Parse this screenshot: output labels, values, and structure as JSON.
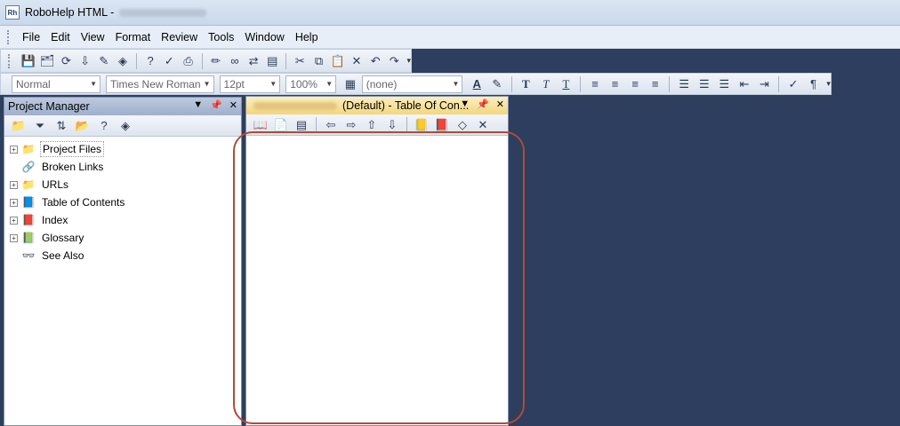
{
  "window": {
    "title": "RoboHelp HTML -",
    "icon_text": "Rh"
  },
  "menu": [
    "File",
    "Edit",
    "View",
    "Format",
    "Review",
    "Tools",
    "Window",
    "Help"
  ],
  "toolbar2": {
    "style": "Normal",
    "font": "Times New Roman",
    "size": "12pt",
    "zoom": "100%",
    "dropdown_value": "(none)"
  },
  "project_manager": {
    "title": "Project Manager",
    "tree": [
      {
        "label": "Project Files",
        "expandable": true,
        "icon": "folder-question-icon"
      },
      {
        "label": "Broken Links",
        "expandable": false,
        "icon": "broken-link-icon"
      },
      {
        "label": "URLs",
        "expandable": true,
        "icon": "url-folder-icon"
      },
      {
        "label": "Table of Contents",
        "expandable": true,
        "icon": "toc-icon"
      },
      {
        "label": "Index",
        "expandable": true,
        "icon": "index-icon"
      },
      {
        "label": "Glossary",
        "expandable": true,
        "icon": "glossary-icon"
      },
      {
        "label": "See Also",
        "expandable": false,
        "icon": "see-also-icon"
      }
    ]
  },
  "toc_panel": {
    "title": "(Default) - Table Of Con..."
  }
}
